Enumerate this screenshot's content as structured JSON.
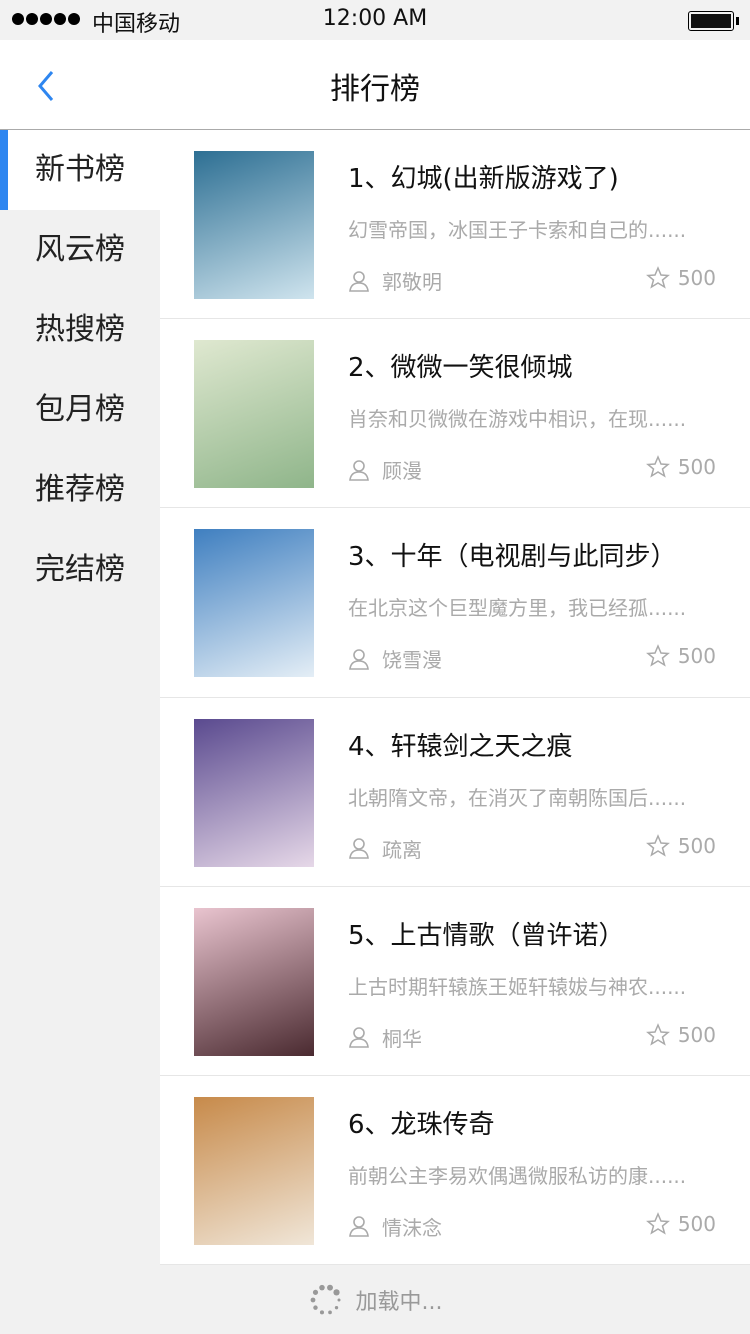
{
  "status": {
    "carrier": "中国移动",
    "time": "12:00 AM"
  },
  "header": {
    "title": "排行榜"
  },
  "sidebar": {
    "items": [
      {
        "label": "新书榜",
        "active": true
      },
      {
        "label": "风云榜"
      },
      {
        "label": "热搜榜"
      },
      {
        "label": "包月榜"
      },
      {
        "label": "推荐榜"
      },
      {
        "label": "完结榜"
      }
    ]
  },
  "books": [
    {
      "title": "1、幻城(出新版游戏了)",
      "desc": "幻雪帝国，冰国王子卡索和自己的......",
      "author": "郭敬明",
      "score": "500",
      "colors": [
        "#2d6f93",
        "#cfe4ee"
      ]
    },
    {
      "title": "2、微微一笑很倾城",
      "desc": "肖奈和贝微微在游戏中相识，在现......",
      "author": "顾漫",
      "score": "500",
      "colors": [
        "#dfe8d0",
        "#8fb58a"
      ]
    },
    {
      "title": "3、十年（电视剧与此同步）",
      "desc": "在北京这个巨型魔方里，我已经孤......",
      "author": "饶雪漫",
      "score": "500",
      "colors": [
        "#3f7fc0",
        "#e4eef6"
      ]
    },
    {
      "title": "4、轩辕剑之天之痕",
      "desc": "北朝隋文帝，在消灭了南朝陈国后......",
      "author": "疏离",
      "score": "500",
      "colors": [
        "#5a4a8f",
        "#e6d8e8"
      ]
    },
    {
      "title": "5、上古情歌（曾许诺）",
      "desc": "上古时期轩辕族王姬轩辕妭与神农......",
      "author": "桐华",
      "score": "500",
      "colors": [
        "#e9c4cf",
        "#4a2a30"
      ]
    },
    {
      "title": "6、龙珠传奇",
      "desc": "前朝公主李易欢偶遇微服私访的康......",
      "author": "情沫念",
      "score": "500",
      "colors": [
        "#c78a4a",
        "#f0e6d8"
      ]
    }
  ],
  "footer": {
    "loading": "加载中..."
  }
}
